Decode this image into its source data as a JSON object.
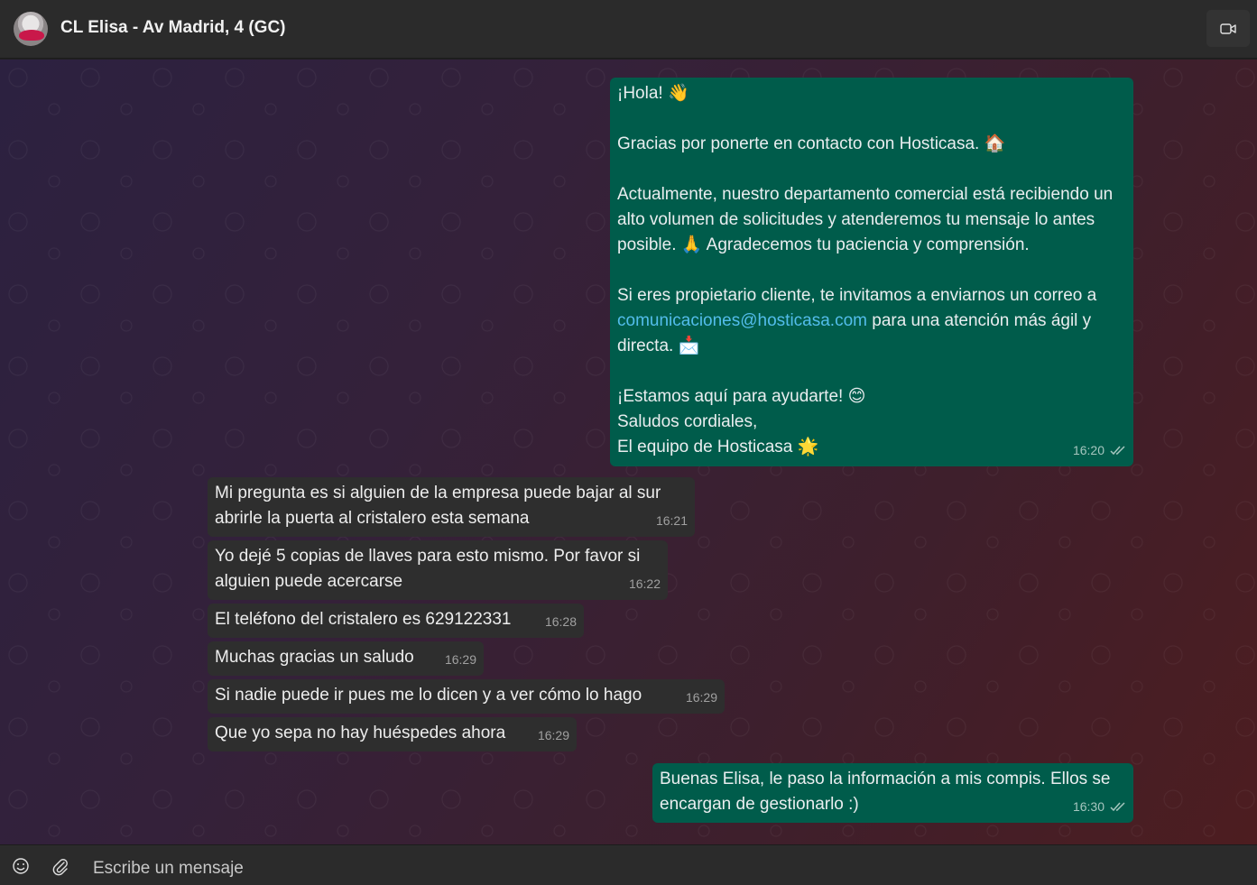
{
  "header": {
    "title": "CL Elisa - Av Madrid, 4 (GC)",
    "video_icon": "video-camera-icon"
  },
  "messages": [
    {
      "direction": "out",
      "lines": {
        "greeting": "¡Hola! 👋",
        "thanks": "Gracias por ponerte en contacto con Hosticasa. 🏠",
        "body1": "Actualmente, nuestro departamento comercial está recibiendo un alto volumen de solicitudes y atenderemos tu mensaje lo antes posible. 🙏 Agradecemos tu paciencia y comprensión.",
        "body2_pre": "Si eres propietario cliente, te invitamos a enviarnos un correo a ",
        "email": "comunicaciones@hosticasa.com",
        "body2_post": " para una atención más ágil y directa. 📩",
        "close1": "¡Estamos aquí para ayudarte! 😊",
        "close2": "Saludos cordiales,",
        "close3": "El equipo de Hosticasa 🌟"
      },
      "time": "16:20"
    },
    {
      "direction": "in",
      "text": "Mi pregunta es si alguien de la empresa puede bajar al sur abrirle la puerta al cristalero esta semana",
      "time": "16:21"
    },
    {
      "direction": "in",
      "text": "Yo dejé 5 copias de llaves para esto mismo. Por favor si alguien puede acercarse",
      "time": "16:22"
    },
    {
      "direction": "in",
      "text": "El teléfono del cristalero es 629122331",
      "time": "16:28"
    },
    {
      "direction": "in",
      "text": "Muchas gracias un saludo",
      "time": "16:29"
    },
    {
      "direction": "in",
      "text": "Si nadie puede ir pues me lo dicen y a ver cómo lo hago",
      "time": "16:29"
    },
    {
      "direction": "in",
      "text": "Que yo sepa no hay huéspedes ahora",
      "time": "16:29"
    },
    {
      "direction": "out",
      "text": "Buenas Elisa, le paso la información a mis compis. Ellos se encargan de gestionarlo :)",
      "time": "16:30"
    }
  ],
  "composer": {
    "placeholder": "Escribe un mensaje",
    "emoji_icon": "emoji-icon",
    "attach_icon": "paperclip-icon"
  }
}
